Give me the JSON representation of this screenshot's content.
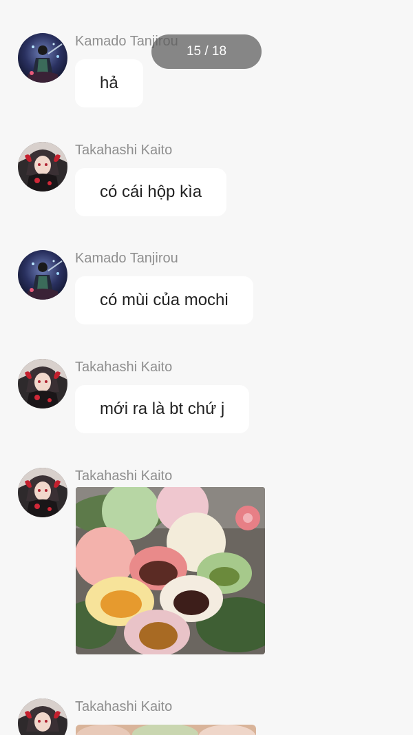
{
  "status_bar": {
    "left": "",
    "right": ""
  },
  "viewer": {
    "page_indicator": "15 / 18"
  },
  "messages": [
    {
      "sender": "Kamado Tanjirou",
      "text": "hả",
      "avatar": "tanjirou-avatar"
    },
    {
      "sender": "Takahashi Kaito",
      "text": "có cái hộp kìa",
      "avatar": "kaito-avatar"
    },
    {
      "sender": "Kamado Tanjirou",
      "text": "có mùi của mochi",
      "avatar": "tanjirou-avatar"
    },
    {
      "sender": "Takahashi Kaito",
      "text": "mới ra là bt chứ j",
      "avatar": "kaito-avatar"
    },
    {
      "sender": "Takahashi Kaito",
      "image": "mochi-photo",
      "avatar": "kaito-avatar"
    },
    {
      "sender": "Takahashi Kaito",
      "image": "photo-partial",
      "avatar": "kaito-avatar"
    }
  ],
  "colors": {
    "background": "#f7f7f7",
    "bubble": "#ffffff",
    "sender_name": "#8f8f8f",
    "indicator_bg": "#5a5a5a"
  }
}
